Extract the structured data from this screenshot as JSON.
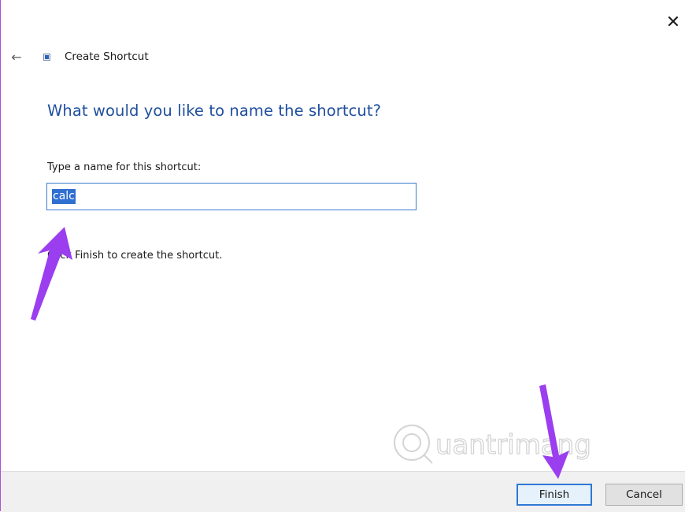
{
  "window": {
    "close_symbol": "✕",
    "back_symbol": "←",
    "title": "Create Shortcut"
  },
  "main": {
    "heading": "What would you like to name the shortcut?",
    "field_label": "Type a name for this shortcut:",
    "input_value": "calc",
    "instruction": "Click Finish to create the shortcut."
  },
  "footer": {
    "finish_label": "Finish",
    "cancel_label": "Cancel"
  },
  "watermark": {
    "text": "uantrimang"
  },
  "icons": {
    "close": "close-icon",
    "back": "arrow-left-icon",
    "shortcut": "shortcut-icon"
  },
  "colors": {
    "heading": "#1f4f9e",
    "selection": "#2f6fd0",
    "annotation_arrow": "#9b3ef0",
    "default_button_border": "#2f78d4"
  }
}
